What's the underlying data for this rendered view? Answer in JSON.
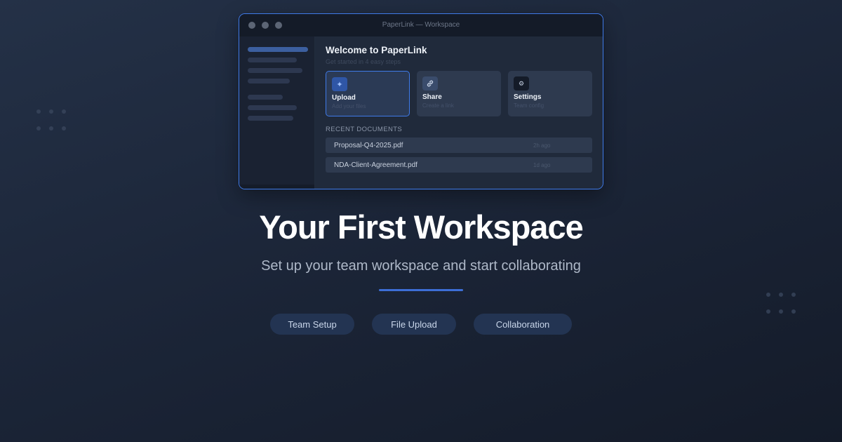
{
  "window": {
    "title": "PaperLink — Workspace",
    "welcome_title": "Welcome to PaperLink",
    "welcome_subtitle": "Get started in 4 easy steps",
    "cards": [
      {
        "label": "Upload",
        "sub": "Add your files",
        "icon": "upload-icon"
      },
      {
        "label": "Share",
        "sub": "Create a link",
        "icon": "link-icon"
      },
      {
        "label": "Settings",
        "sub": "Team config",
        "icon": "gear-icon"
      }
    ],
    "recent_label": "RECENT DOCUMENTS",
    "documents": [
      {
        "name": "Proposal-Q4-2025.pdf",
        "time": "2h ago"
      },
      {
        "name": "NDA-Client-Agreement.pdf",
        "time": "1d ago"
      }
    ]
  },
  "hero": {
    "headline": "Your First Workspace",
    "tagline": "Set up your team workspace and start collaborating"
  },
  "pills": [
    "Team Setup",
    "File Upload",
    "Collaboration"
  ],
  "colors": {
    "accent": "#3f7ae8",
    "pill_bg": "#233452",
    "background": "#1c2639"
  }
}
